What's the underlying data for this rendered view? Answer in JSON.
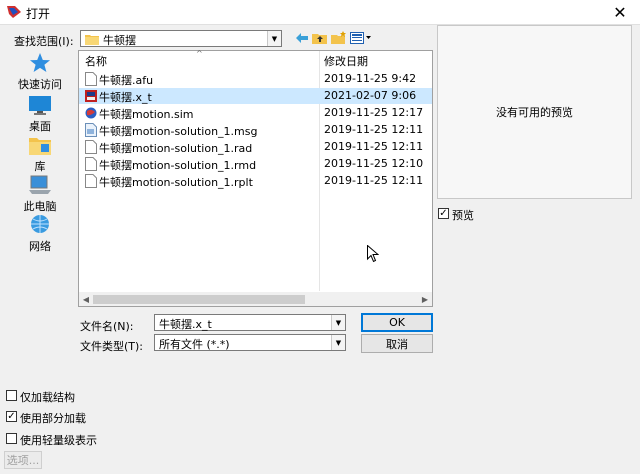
{
  "window": {
    "title": "打开",
    "close_glyph": "✕"
  },
  "lookin": {
    "label": "查找范围(I):",
    "value": "牛顿摆"
  },
  "toolbar": {
    "back_icon": "back-arrow-icon",
    "up_icon": "up-folder-icon",
    "new_folder_icon": "new-folder-icon",
    "view_icon": "view-menu-icon"
  },
  "places": [
    {
      "label": "快速访问",
      "icon": "star-icon"
    },
    {
      "label": "桌面",
      "icon": "desktop-icon"
    },
    {
      "label": "库",
      "icon": "library-icon"
    },
    {
      "label": "此电脑",
      "icon": "computer-icon"
    },
    {
      "label": "网络",
      "icon": "network-icon"
    }
  ],
  "filelist": {
    "col_name": "名称",
    "col_date": "修改日期",
    "sort_glyph": "^",
    "rows": [
      {
        "name": "牛顿摆.afu",
        "date": "2019-11-25 9:42",
        "icon": "file-icon",
        "selected": false
      },
      {
        "name": "牛顿摆.x_t",
        "date": "2021-02-07 9:06",
        "icon": "part-icon",
        "selected": true
      },
      {
        "name": "牛顿摆motion.sim",
        "date": "2019-11-25 12:17",
        "icon": "sim-icon",
        "selected": false
      },
      {
        "name": "牛顿摆motion-solution_1.msg",
        "date": "2019-11-25 12:11",
        "icon": "msg-icon",
        "selected": false
      },
      {
        "name": "牛顿摆motion-solution_1.rad",
        "date": "2019-11-25 12:11",
        "icon": "file-icon",
        "selected": false
      },
      {
        "name": "牛顿摆motion-solution_1.rmd",
        "date": "2019-11-25 12:10",
        "icon": "file-icon",
        "selected": false
      },
      {
        "name": "牛顿摆motion-solution_1.rplt",
        "date": "2019-11-25 12:11",
        "icon": "file-icon",
        "selected": false
      }
    ]
  },
  "preview": {
    "text": "没有可用的预览",
    "checkbox_label": "预览",
    "checked": true
  },
  "filename": {
    "label": "文件名(N):",
    "value": "牛顿摆.x_t"
  },
  "filetype": {
    "label": "文件类型(T):",
    "value": "所有文件 (*.*)"
  },
  "buttons": {
    "ok": "OK",
    "cancel": "取消",
    "options": "选项..."
  },
  "options": [
    {
      "label": "仅加载结构",
      "checked": false
    },
    {
      "label": "使用部分加载",
      "checked": true
    },
    {
      "label": "使用轻量级表示",
      "checked": false
    }
  ],
  "colors": {
    "selection": "#cce8ff",
    "accent": "#0078d7"
  }
}
